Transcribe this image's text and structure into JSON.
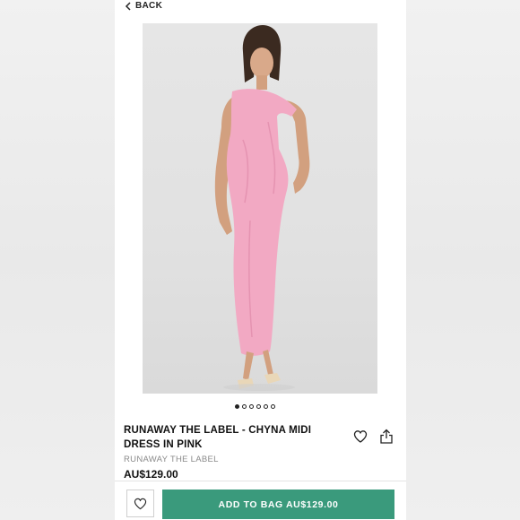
{
  "nav": {
    "back_label": "BACK",
    "back_icon": "chevron-left-icon"
  },
  "product": {
    "title": "RUNAWAY THE LABEL - CHYNA MIDI DRESS IN PINK",
    "brand": "RUNAWAY THE LABEL",
    "price": "AU$129.00",
    "image_count": 6,
    "active_image": 1
  },
  "actions": {
    "wishlist_icon": "heart-icon",
    "share_icon": "share-icon",
    "add_to_bag_label": "ADD TO BAG AU$129.00"
  },
  "colors": {
    "accent": "#3a9a7c",
    "dress": "#f2a9c3"
  }
}
